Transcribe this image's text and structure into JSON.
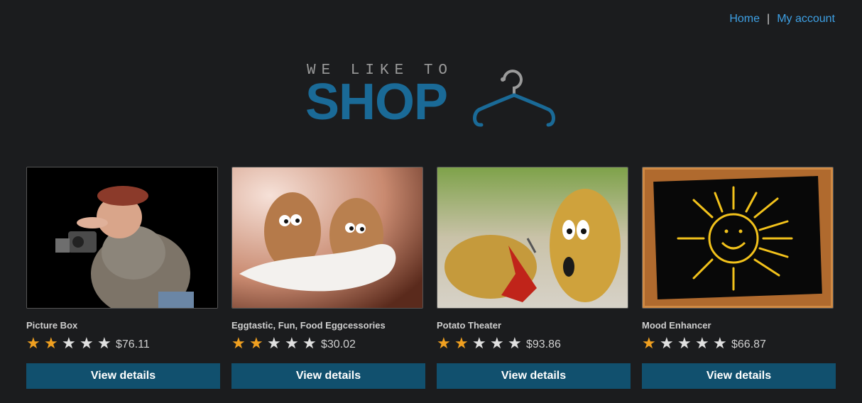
{
  "nav": {
    "home": "Home",
    "separator": "|",
    "account": "My account"
  },
  "logo": {
    "tagline": "WE LIKE TO",
    "word": "SHOP",
    "icon": "hanger-icon"
  },
  "products": [
    {
      "name": "Picture Box",
      "stars": 2,
      "max_stars": 5,
      "price": "$76.11",
      "button": "View details",
      "image": "photographer-figurine"
    },
    {
      "name": "Eggtastic, Fun, Food Eggcessories",
      "stars": 2,
      "max_stars": 5,
      "price": "$30.02",
      "button": "View details",
      "image": "eggs-with-eyes"
    },
    {
      "name": "Potato Theater",
      "stars": 2,
      "max_stars": 5,
      "price": "$93.86",
      "button": "View details",
      "image": "potatoes-with-eyes"
    },
    {
      "name": "Mood Enhancer",
      "stars": 1,
      "max_stars": 5,
      "price": "$66.87",
      "button": "View details",
      "image": "sun-chalkboard"
    }
  ],
  "colors": {
    "background": "#1b1c1e",
    "link": "#3ea0e4",
    "button": "#11506e",
    "logo": "#1a6a97",
    "star_on": "#f0a020",
    "star_off": "#e0e0e0"
  }
}
